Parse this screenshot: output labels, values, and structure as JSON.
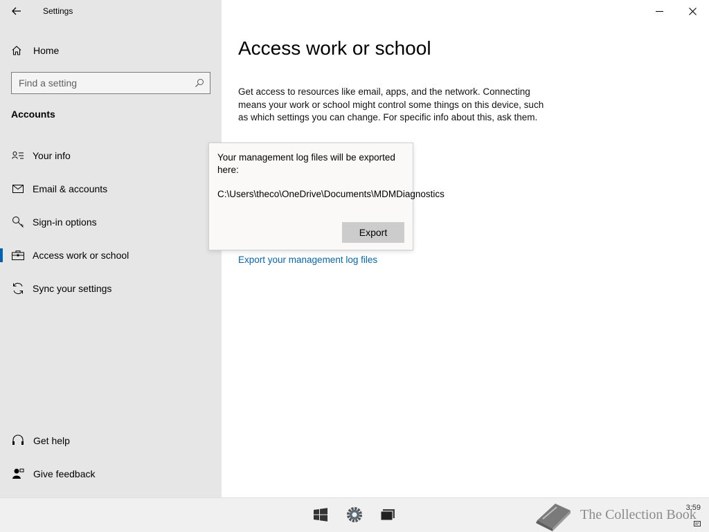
{
  "window": {
    "title": "Settings",
    "back_icon": "back-arrow-icon",
    "minimize_icon": "minimize-icon",
    "close_icon": "close-icon"
  },
  "sidebar": {
    "home_label": "Home",
    "search_placeholder": "Find a setting",
    "section_title": "Accounts",
    "items": [
      {
        "label": "Your info",
        "icon": "person-card-icon"
      },
      {
        "label": "Email & accounts",
        "icon": "mail-icon"
      },
      {
        "label": "Sign-in options",
        "icon": "key-icon"
      },
      {
        "label": "Access work or school",
        "icon": "briefcase-icon",
        "active": true
      },
      {
        "label": "Sync your settings",
        "icon": "sync-icon"
      }
    ],
    "bottom": [
      {
        "label": "Get help",
        "icon": "help-icon"
      },
      {
        "label": "Give feedback",
        "icon": "feedback-icon"
      }
    ]
  },
  "main": {
    "title": "Access work or school",
    "description": "Get access to resources like email, apps, and the network. Connecting means your work or school might control some things on this device, such as which settings you can change. For specific info about this, ask them.",
    "export_link": "Export your management log files"
  },
  "flyout": {
    "message": "Your management log files will be exported here:",
    "path": "C:\\Users\\theco\\OneDrive\\Documents\\MDMDiagnostics",
    "button": "Export"
  },
  "taskbar": {
    "watermark": "The Collection Book",
    "clock": "3:59"
  },
  "colors": {
    "accent": "#0063b1",
    "link": "#0066b4",
    "sidebar_bg": "#e6e6e6"
  }
}
